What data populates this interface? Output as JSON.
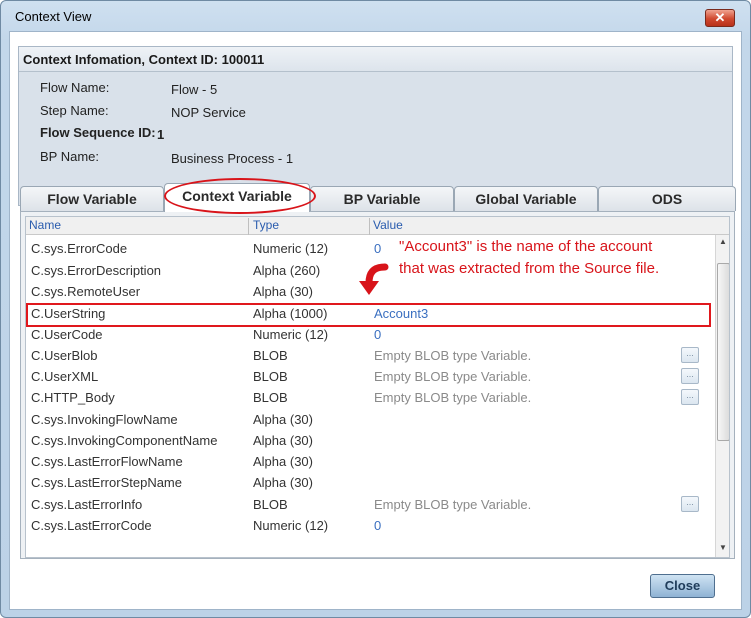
{
  "window": {
    "title": "Context View",
    "close_glyph": "✕"
  },
  "context": {
    "header": "Context Infomation, Context ID: 100011",
    "fields": [
      {
        "label": "Flow Name:",
        "value": "Flow - 5"
      },
      {
        "label": "Step Name:",
        "value": "NOP Service"
      },
      {
        "label": "Flow Sequence ID:",
        "value": "1"
      },
      {
        "label": "BP Name:",
        "value": "Business Process - 1"
      }
    ]
  },
  "tabs": [
    "Flow Variable",
    "Context Variable",
    "BP Variable",
    "Global Variable",
    "ODS"
  ],
  "active_tab": "Context Variable",
  "grid": {
    "columns": [
      "Name",
      "Type",
      "Value"
    ],
    "rows": [
      {
        "name": "C.sys.ErrorCode",
        "type": "Numeric (12)",
        "value": "0"
      },
      {
        "name": "C.sys.ErrorDescription",
        "type": "Alpha (260)",
        "value": ""
      },
      {
        "name": "C.sys.RemoteUser",
        "type": "Alpha (30)",
        "value": ""
      },
      {
        "name": "C.UserString",
        "type": "Alpha (1000)",
        "value": "Account3"
      },
      {
        "name": "C.UserCode",
        "type": "Numeric (12)",
        "value": "0"
      },
      {
        "name": "C.UserBlob",
        "type": "BLOB",
        "value": "Empty BLOB type Variable."
      },
      {
        "name": "C.UserXML",
        "type": "BLOB",
        "value": "Empty BLOB type Variable."
      },
      {
        "name": "C.HTTP_Body",
        "type": "BLOB",
        "value": "Empty BLOB type Variable."
      },
      {
        "name": "C.sys.InvokingFlowName",
        "type": "Alpha (30)",
        "value": ""
      },
      {
        "name": "C.sys.InvokingComponentName",
        "type": "Alpha (30)",
        "value": ""
      },
      {
        "name": "C.sys.LastErrorFlowName",
        "type": "Alpha (30)",
        "value": ""
      },
      {
        "name": "C.sys.LastErrorStepName",
        "type": "Alpha (30)",
        "value": ""
      },
      {
        "name": "C.sys.LastErrorInfo",
        "type": "BLOB",
        "value": "Empty BLOB type Variable."
      },
      {
        "name": "C.sys.LastErrorCode",
        "type": "Numeric (12)",
        "value": "0"
      }
    ],
    "blob_button_label": "..."
  },
  "annotation": {
    "line1": "\"Account3\"  is the name of the account",
    "line2": "that was extracted from the Source file."
  },
  "colors": {
    "highlight": "#e0181d",
    "accent_blue": "#3a6fc0"
  },
  "footer": {
    "close_label": "Close"
  }
}
